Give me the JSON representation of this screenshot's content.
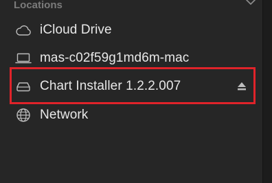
{
  "sidebar": {
    "section_title": "Locations",
    "items": [
      {
        "label": "iCloud Drive",
        "icon": "cloud-icon"
      },
      {
        "label": "mas-c02f59g1md6m-mac",
        "icon": "laptop-icon"
      },
      {
        "label": "Chart Installer 1.2.2.007",
        "icon": "disk-icon",
        "ejectable": true
      },
      {
        "label": "Network",
        "icon": "globe-icon"
      }
    ]
  },
  "colors": {
    "background": "#262626",
    "section_header": "#7b7b7b",
    "item_text": "#e8e8e8",
    "icon": "#bdbdbd",
    "highlight": "#e0232a"
  }
}
